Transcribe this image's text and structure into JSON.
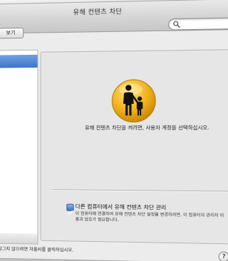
{
  "window": {
    "title": "유해 컨텐츠 차단"
  },
  "toolbar": {
    "show_all_label": "보기"
  },
  "search": {
    "placeholder": ""
  },
  "main": {
    "icon": "parental-controls-icon",
    "prompt": "유해 컨텐츠 차단을 켜려면, 사용자 계정을 선택하십시오.",
    "checkbox": {
      "label": "다른 컴퓨터에서 유해 컨텐츠 차단 관리",
      "checked": true,
      "description": "이 컴퓨터에 연결하여 유해 컨텐츠 차단 설정을 변경하려면, 이 컴퓨터의 관리자 이름과 암호가 필요합니다."
    }
  },
  "footer": {
    "lock_text": "잠그지 않으려면 자물쇠를 클릭하십시오.",
    "help_label": "?"
  },
  "colors": {
    "accent": "#3f74c8",
    "icon_yellow": "#f2b21e",
    "panel": "#e6e6e6"
  }
}
